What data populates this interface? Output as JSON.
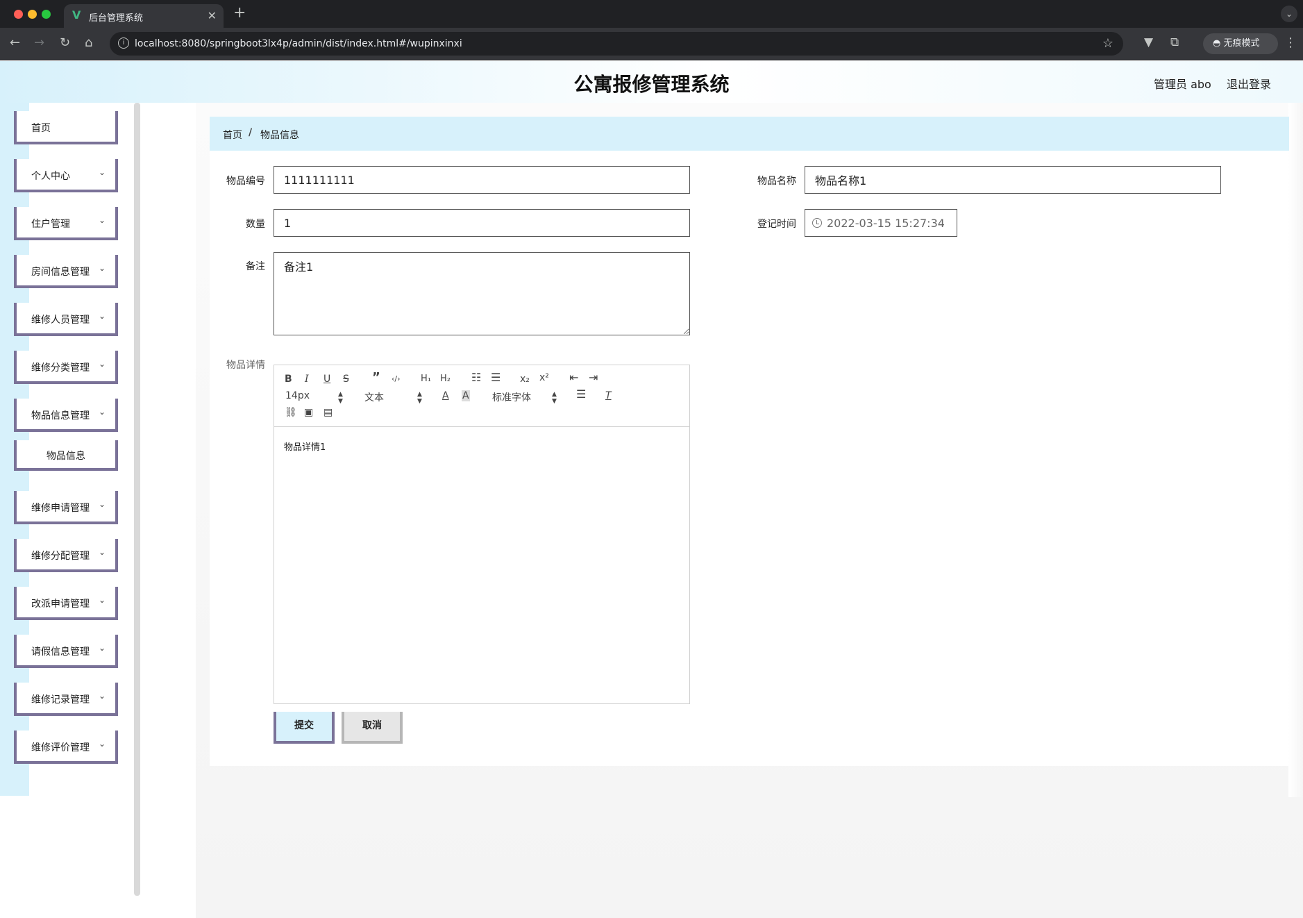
{
  "browser": {
    "tab_title": "后台管理系统",
    "url": "localhost:8080/springboot3lx4p/admin/dist/index.html#/wupinxinxi",
    "incognito_label": "无痕模式"
  },
  "header": {
    "title": "公寓报修管理系统",
    "user_label": "管理员 abo",
    "logout_label": "退出登录"
  },
  "sidebar": {
    "items": [
      {
        "label": "首页",
        "has_children": false
      },
      {
        "label": "个人中心",
        "has_children": true
      },
      {
        "label": "住户管理",
        "has_children": true
      },
      {
        "label": "房间信息管理",
        "has_children": true
      },
      {
        "label": "维修人员管理",
        "has_children": true
      },
      {
        "label": "维修分类管理",
        "has_children": true
      },
      {
        "label": "物品信息管理",
        "has_children": true,
        "expanded": true
      },
      {
        "label": "物品信息",
        "submenu": true
      },
      {
        "label": "维修申请管理",
        "has_children": true
      },
      {
        "label": "维修分配管理",
        "has_children": true
      },
      {
        "label": "改派申请管理",
        "has_children": true
      },
      {
        "label": "请假信息管理",
        "has_children": true
      },
      {
        "label": "维修记录管理",
        "has_children": true
      },
      {
        "label": "维修评价管理",
        "has_children": true
      }
    ]
  },
  "breadcrumb": {
    "home": "首页",
    "separator": "/",
    "current": "物品信息"
  },
  "form": {
    "item_code_label": "物品编号",
    "item_code_value": "1111111111",
    "item_name_label": "物品名称",
    "item_name_value": "物品名称1",
    "quantity_label": "数量",
    "quantity_value": "1",
    "register_time_label": "登记时间",
    "register_time_value": "2022-03-15 15:27:34",
    "remark_label": "备注",
    "remark_value": "备注1",
    "detail_label": "物品详情",
    "detail_content": "物品详情1"
  },
  "editor_toolbar": {
    "font_size": "14px",
    "header_select": "文本",
    "font_family": "标准字体"
  },
  "buttons": {
    "submit": "提交",
    "cancel": "取消"
  },
  "colors": {
    "accent_light_blue": "#d7f1fb",
    "menu_border": "#7a7298"
  }
}
